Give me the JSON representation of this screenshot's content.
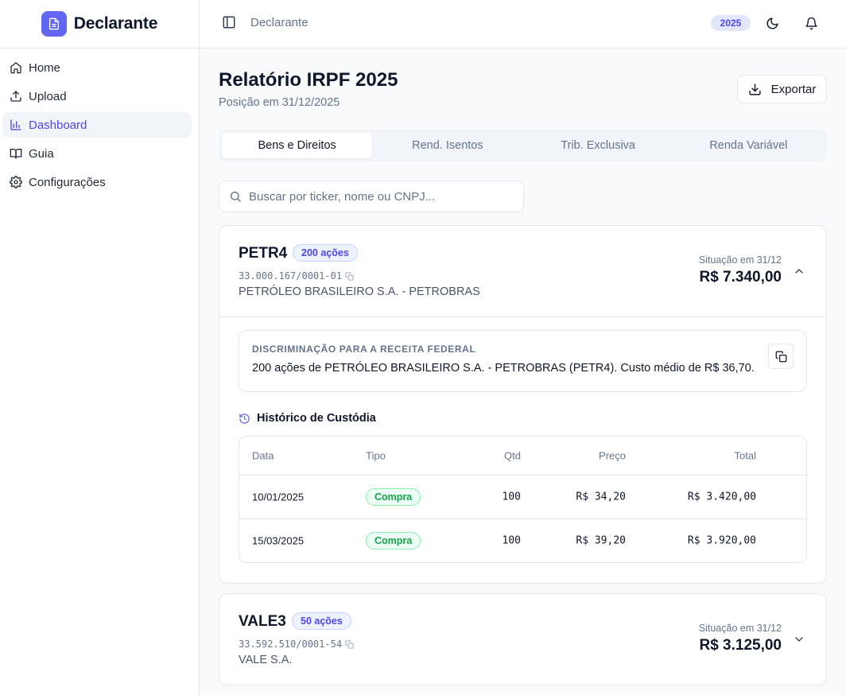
{
  "app": {
    "name": "Declarante",
    "logo_icon": "document-icon",
    "accent_color": "#6366f1"
  },
  "sidebar": {
    "items": [
      {
        "label": "Home",
        "icon": "home-icon",
        "active": false
      },
      {
        "label": "Upload",
        "icon": "upload-icon",
        "active": false
      },
      {
        "label": "Dashboard",
        "icon": "bar-chart-icon",
        "active": true
      },
      {
        "label": "Guia",
        "icon": "book-icon",
        "active": false
      },
      {
        "label": "Configurações",
        "icon": "gear-icon",
        "active": false
      }
    ]
  },
  "topbar": {
    "breadcrumb": "Declarante",
    "year": "2025",
    "icons": [
      "sidebar-toggle-icon",
      "moon-icon",
      "bell-icon"
    ]
  },
  "page": {
    "title": "Relatório IRPF 2025",
    "subtitle": "Posição em 31/12/2025",
    "export_label": "Exportar"
  },
  "tabs": [
    {
      "label": "Bens e Direitos",
      "active": true
    },
    {
      "label": "Rend. Isentos",
      "active": false
    },
    {
      "label": "Trib. Exclusiva",
      "active": false
    },
    {
      "label": "Renda Variável",
      "active": false
    }
  ],
  "search": {
    "placeholder": "Buscar por ticker, nome ou CNPJ...",
    "value": ""
  },
  "assets": [
    {
      "ticker": "PETR4",
      "quantity": "200 ações",
      "cnpj": "33.000.167/0001-01",
      "company": "PETRÓLEO BRASILEIRO S.A. - PETROBRAS",
      "situation_label": "Situação em 31/12",
      "situation_value": "R$ 7.340,00",
      "expanded": true,
      "discrimination_title": "DISCRIMINAÇÃO PARA A RECEITA FEDERAL",
      "discrimination_text": "200 ações de PETRÓLEO BRASILEIRO S.A. - PETROBRAS (PETR4). Custo médio de R$ 36,70.",
      "history_title": "Histórico de Custódia",
      "history_columns": [
        "Data",
        "Tipo",
        "Qtd",
        "Preço",
        "Total"
      ],
      "history_rows": [
        {
          "date": "10/01/2025",
          "type": "Compra",
          "qty": "100",
          "price": "R$ 34,20",
          "total": "R$ 3.420,00"
        },
        {
          "date": "15/03/2025",
          "type": "Compra",
          "qty": "100",
          "price": "R$ 39,20",
          "total": "R$ 3.920,00"
        }
      ]
    },
    {
      "ticker": "VALE3",
      "quantity": "50 ações",
      "cnpj": "33.592.510/0001-54",
      "company": "VALE S.A.",
      "situation_label": "Situação em 31/12",
      "situation_value": "R$ 3.125,00",
      "expanded": false
    }
  ]
}
